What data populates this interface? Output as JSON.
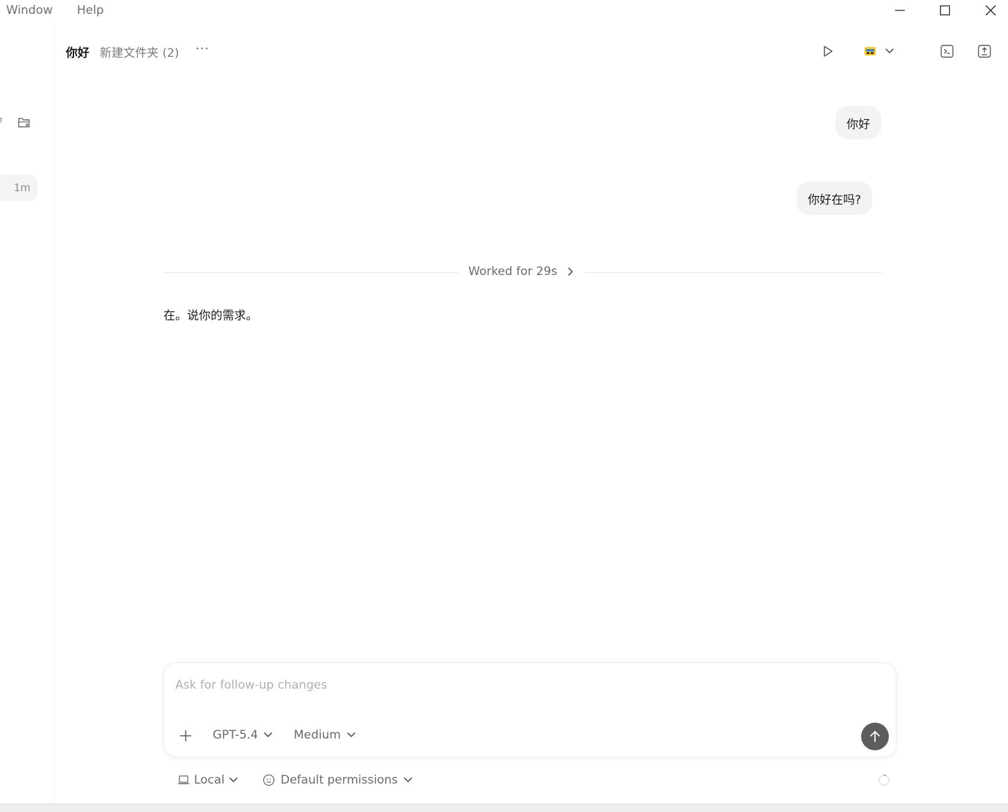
{
  "menubar": {
    "items": [
      {
        "label": "Window"
      },
      {
        "label": "Help"
      }
    ]
  },
  "sidebar": {
    "recent_time": "1m"
  },
  "header": {
    "thread_title": "你好",
    "folder_name": "新建文件夹 (2)",
    "more_label": "···"
  },
  "messages": {
    "user": [
      "你好",
      "你好在吗?"
    ],
    "worked_label": "Worked for 29s",
    "assistant": "在。说你的需求。"
  },
  "composer": {
    "placeholder": "Ask for follow-up changes",
    "model": "GPT-5.4",
    "effort": "Medium"
  },
  "footer": {
    "environment": "Local",
    "permissions": "Default permissions"
  },
  "colors": {
    "send_button": "#5d5d5d",
    "bubble_bg": "#f3f3f3",
    "muted_text": "#6a6a6a"
  },
  "icons": [
    "minimize-icon",
    "maximize-icon",
    "close-icon",
    "new-folder-icon",
    "play-icon",
    "ide-icon",
    "chevron-down-icon",
    "terminal-icon",
    "commit-icon",
    "chevron-right-icon",
    "plus-icon",
    "arrow-up-icon",
    "laptop-icon",
    "shield-icon",
    "spinner-icon"
  ]
}
